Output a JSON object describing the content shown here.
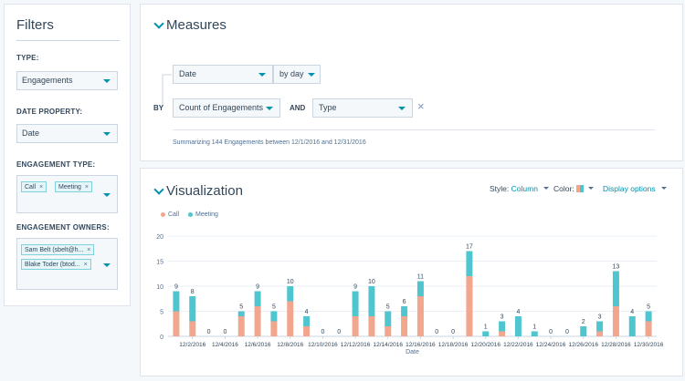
{
  "filters": {
    "title": "Filters",
    "type_label": "TYPE:",
    "type_value": "Engagements",
    "date_property_label": "DATE PROPERTY:",
    "date_property_value": "Date",
    "engagement_type_label": "ENGAGEMENT TYPE:",
    "engagement_type_tags": [
      "Call",
      "Meeting"
    ],
    "engagement_owners_label": "ENGAGEMENT OWNERS:",
    "engagement_owners_tags": [
      "Sam Belt (sbelt@h...",
      "Blake Toder (btod..."
    ],
    "tag_remove": "×"
  },
  "measures": {
    "title": "Measures",
    "date_select": "Date",
    "frequency_select": "by day",
    "by_label": "BY",
    "count_select": "Count of Engagements",
    "and_label": "AND",
    "type_select": "Type",
    "remove_icon": "×",
    "summary": "Summarizing 144 Engagements between 12/1/2016 and 12/31/2016"
  },
  "visualization": {
    "title": "Visualization",
    "style_label": "Style:",
    "style_value": "Column",
    "color_label": "Color:",
    "display_options": "Display options",
    "colors": {
      "call": "#f2a68e",
      "meeting": "#4fc6cf",
      "accent": "#0091ae"
    }
  },
  "chart_data": {
    "type": "bar",
    "stacked": true,
    "xlabel": "Date",
    "ylabel": "",
    "ylim": [
      0,
      20
    ],
    "yticks": [
      0,
      5,
      10,
      15,
      20
    ],
    "grid": true,
    "legend_position": "top-left",
    "categories": [
      "12/1/2016",
      "12/2/2016",
      "12/3/2016",
      "12/4/2016",
      "12/5/2016",
      "12/6/2016",
      "12/7/2016",
      "12/8/2016",
      "12/9/2016",
      "12/10/2016",
      "12/11/2016",
      "12/12/2016",
      "12/13/2016",
      "12/14/2016",
      "12/15/2016",
      "12/16/2016",
      "12/17/2016",
      "12/18/2016",
      "12/19/2016",
      "12/20/2016",
      "12/21/2016",
      "12/22/2016",
      "12/23/2016",
      "12/24/2016",
      "12/25/2016",
      "12/26/2016",
      "12/27/2016",
      "12/28/2016",
      "12/29/2016",
      "12/30/2016"
    ],
    "tick_labels": [
      "12/2/2016",
      "12/4/2016",
      "12/6/2016",
      "12/8/2016",
      "12/10/2016",
      "12/12/2016",
      "12/14/2016",
      "12/16/2016",
      "12/18/2016",
      "12/20/2016",
      "12/22/2016",
      "12/24/2016",
      "12/26/2016",
      "12/28/2016",
      "12/30/2016"
    ],
    "series": [
      {
        "name": "Call",
        "color": "#f2a68e",
        "values": [
          5,
          3,
          0,
          0,
          4,
          6,
          3,
          7,
          2,
          0,
          0,
          4,
          4,
          2,
          4,
          8,
          0,
          0,
          12,
          0,
          1,
          0,
          0,
          0,
          0,
          0,
          1,
          6,
          0,
          3
        ]
      },
      {
        "name": "Meeting",
        "color": "#4fc6cf",
        "values": [
          4,
          5,
          0,
          0,
          1,
          3,
          2,
          3,
          2,
          0,
          0,
          5,
          6,
          3,
          2,
          3,
          0,
          0,
          5,
          1,
          2,
          4,
          1,
          0,
          0,
          2,
          2,
          7,
          4,
          2
        ]
      }
    ],
    "totals": [
      9,
      8,
      0,
      0,
      5,
      9,
      5,
      10,
      4,
      0,
      0,
      9,
      10,
      5,
      6,
      11,
      0,
      0,
      17,
      1,
      3,
      4,
      1,
      0,
      0,
      2,
      3,
      13,
      4,
      5
    ]
  }
}
